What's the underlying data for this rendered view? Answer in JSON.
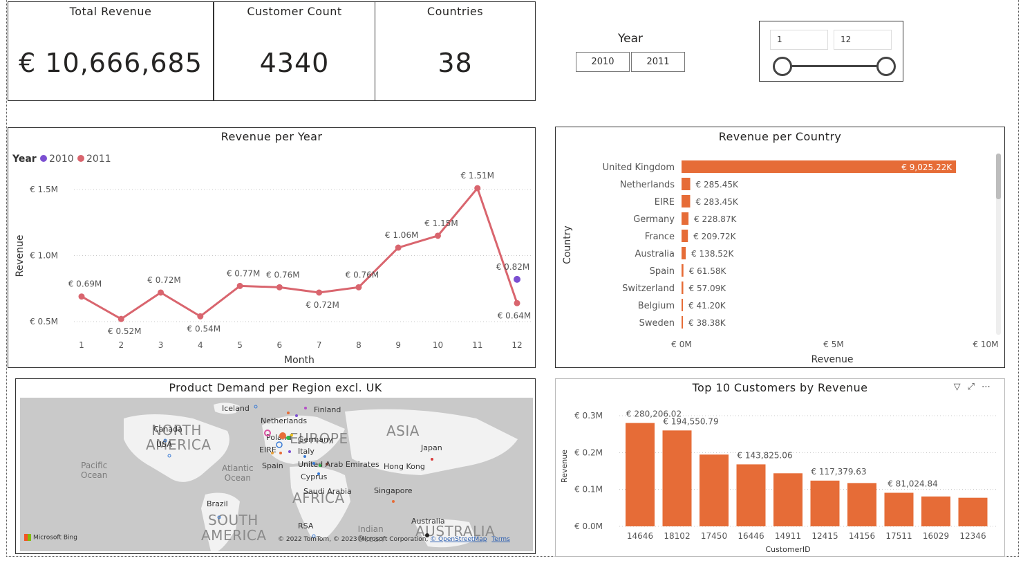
{
  "kpis": [
    {
      "title": "Total Revenue",
      "value": "€ 10,666,685"
    },
    {
      "title": "Customer Count",
      "value": "4340"
    },
    {
      "title": "Countries",
      "value": "38"
    }
  ],
  "year_slicer": {
    "title": "Year",
    "options": [
      "2010",
      "2011"
    ]
  },
  "month_slicer": {
    "min_value": "1",
    "max_value": "12"
  },
  "revenue_per_year": {
    "title": "Revenue per Year",
    "legend_title": "Year",
    "xlabel": "Month",
    "ylabel": "Revenue",
    "y_ticks": [
      "€ 0.5M",
      "€ 1.0M",
      "€ 1.5M"
    ],
    "point_labels_2011": [
      "€ 0.69M",
      "€ 0.52M",
      "€ 0.72M",
      "€ 0.54M",
      "€ 0.77M",
      "€ 0.76M",
      "€ 0.72M",
      "€ 0.76M",
      "€ 1.06M",
      "€ 1.15M",
      "€ 1.51M",
      "€ 0.64M"
    ],
    "point_labels_2010": [
      "€ 0.82M"
    ]
  },
  "revenue_per_country": {
    "title": "Revenue per Country",
    "xlabel": "Revenue",
    "ylabel": "Country",
    "x_ticks": [
      "€ 0M",
      "€ 5M",
      "€ 10M"
    ],
    "value_labels": [
      "€ 9,025.22K",
      "€ 285.45K",
      "€ 283.45K",
      "€ 228.87K",
      "€ 209.72K",
      "€ 138.52K",
      "€ 61.58K",
      "€ 57.09K",
      "€ 41.20K",
      "€ 38.38K"
    ]
  },
  "product_demand_map": {
    "title": "Product Demand per Region excl. UK",
    "continents": [
      "NORTH",
      "AMERICA",
      "SOUTH",
      "AMERICA",
      "EUROPE",
      "ASIA",
      "AFRICA",
      "AUSTRALIA"
    ],
    "oceans": [
      "Pacific",
      "Ocean",
      "Atlantic",
      "Ocean",
      "Indian",
      "Ocean"
    ],
    "places": [
      "Canada",
      "USA",
      "Iceland",
      "Finland",
      "Netherlands",
      "Poland",
      "Germany",
      "EIRE",
      "Italy",
      "Spain",
      "United Arab Emirates",
      "Cyprus",
      "Saudi Arabia",
      "Hong Kong",
      "Japan",
      "Singapore",
      "Brazil",
      "RSA",
      "Australia"
    ],
    "bing_label": "Microsoft Bing",
    "credit": "© 2022 TomTom, © 2023 Microsoft Corporation,",
    "osm_link": "© OpenStreetMap",
    "terms_link": "Terms"
  },
  "top_customers": {
    "title": "Top 10 Customers by Revenue",
    "xlabel": "CustomerID",
    "ylabel": "Revenue",
    "y_ticks": [
      "€ 0.0M",
      "€ 0.1M",
      "€ 0.2M",
      "€ 0.3M"
    ],
    "data_labels": [
      {
        "index": 0,
        "text": "€ 280,206.02"
      },
      {
        "index": 1,
        "text": "€ 194,550.79"
      },
      {
        "index": 3,
        "text": "€ 143,825.06"
      },
      {
        "index": 5,
        "text": "€ 117,379.63"
      },
      {
        "index": 7,
        "text": "€ 81,024.84"
      }
    ]
  },
  "colors": {
    "series_2010": "#7B4FD1",
    "series_2011": "#D9656E",
    "bar_orange": "#E66C37",
    "map_bg": "#C9C9C9"
  },
  "chart_data": [
    {
      "type": "line",
      "title": "Revenue per Year",
      "xlabel": "Month",
      "ylabel": "Revenue",
      "x": [
        1,
        2,
        3,
        4,
        5,
        6,
        7,
        8,
        9,
        10,
        11,
        12
      ],
      "ylim": [
        0.4,
        1.55
      ],
      "series": [
        {
          "name": "2011",
          "values": [
            0.69,
            0.52,
            0.72,
            0.54,
            0.77,
            0.76,
            0.72,
            0.76,
            1.06,
            1.15,
            1.51,
            0.64
          ]
        },
        {
          "name": "2010",
          "x": [
            12
          ],
          "values": [
            0.82
          ]
        }
      ],
      "legend": "top-left",
      "grid": true
    },
    {
      "type": "bar",
      "orientation": "horizontal",
      "title": "Revenue per Country",
      "xlabel": "Revenue",
      "ylabel": "Country",
      "categories": [
        "United Kingdom",
        "Netherlands",
        "EIRE",
        "Germany",
        "France",
        "Australia",
        "Spain",
        "Switzerland",
        "Belgium",
        "Sweden"
      ],
      "values": [
        9025.22,
        285.45,
        283.45,
        228.87,
        209.72,
        138.52,
        61.58,
        57.09,
        41.2,
        38.38
      ],
      "unit": "K",
      "xlim": [
        0,
        10000
      ]
    },
    {
      "type": "bar",
      "title": "Top 10 Customers by Revenue",
      "xlabel": "CustomerID",
      "ylabel": "Revenue",
      "categories": [
        "14646",
        "18102",
        "17450",
        "16446",
        "14911",
        "12415",
        "14156",
        "17511",
        "16029",
        "12346"
      ],
      "values": [
        280206.02,
        260000,
        194550.79,
        168000,
        143825.06,
        124000,
        117379.63,
        91000,
        81024.84,
        77500
      ],
      "ylim": [
        0,
        300000
      ],
      "grid": true
    }
  ]
}
